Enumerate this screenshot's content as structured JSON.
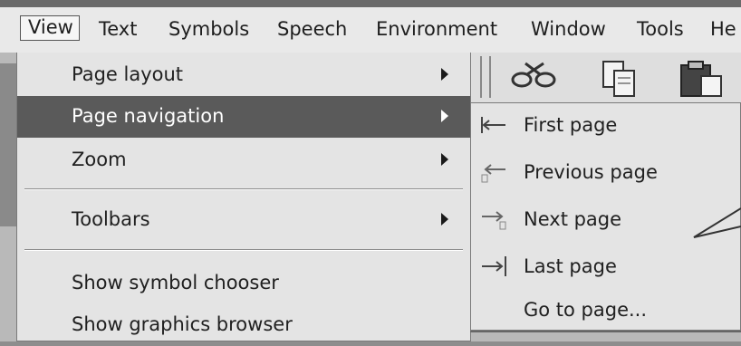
{
  "menubar": {
    "items": [
      {
        "label": "View",
        "active": true
      },
      {
        "label": "Text"
      },
      {
        "label": "Symbols"
      },
      {
        "label": "Speech"
      },
      {
        "label": "Environment"
      },
      {
        "label": "Window"
      },
      {
        "label": "Tools"
      },
      {
        "label": "He"
      }
    ]
  },
  "view_menu": {
    "items": [
      {
        "label": "Page layout",
        "has_submenu": true
      },
      {
        "label": "Page navigation",
        "has_submenu": true,
        "highlighted": true
      },
      {
        "label": "Zoom",
        "has_submenu": true
      },
      {
        "label": "Toolbars",
        "has_submenu": true
      },
      {
        "label": "Show symbol chooser"
      },
      {
        "label": "Show graphics browser"
      }
    ]
  },
  "page_navigation_submenu": {
    "items": [
      {
        "label": "First page",
        "icon": "first-page-icon"
      },
      {
        "label": "Previous page",
        "icon": "previous-page-icon"
      },
      {
        "label": "Next page",
        "icon": "next-page-icon"
      },
      {
        "label": "Last page",
        "icon": "last-page-icon"
      },
      {
        "label": "Go to page...",
        "icon": null
      }
    ]
  },
  "toolbar": {
    "icons": [
      "cut-icon",
      "copy-icon",
      "paste-icon"
    ]
  },
  "colors": {
    "highlight": "#5a5a5a",
    "menu_bg": "#e4e4e4",
    "menubar_bg": "#e9e9e9"
  }
}
